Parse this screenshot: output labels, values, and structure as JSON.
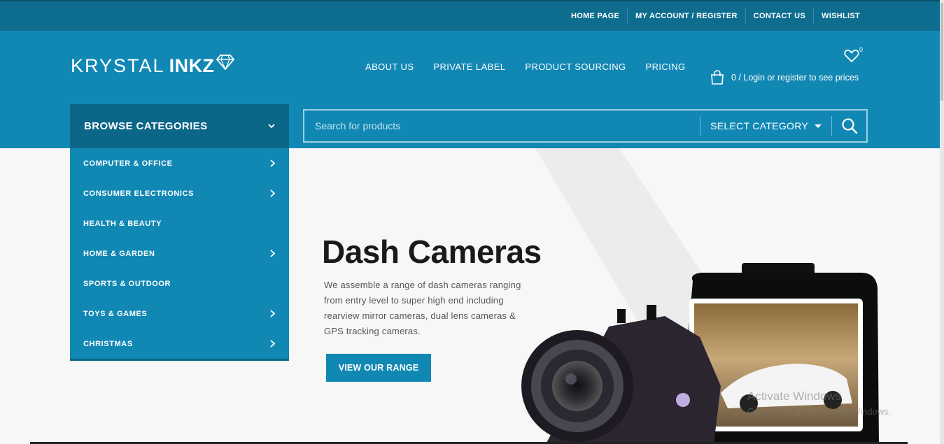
{
  "topbar": {
    "links": [
      "HOME PAGE",
      "MY ACCOUNT / REGISTER",
      "CONTACT US",
      "WISHLIST"
    ]
  },
  "logo": {
    "light": "KRYSTAL",
    "bold": "INKZ"
  },
  "mainnav": [
    "ABOUT US",
    "PRIVATE LABEL",
    "PRODUCT SOURCING",
    "PRICING"
  ],
  "wishlist": {
    "count": "0"
  },
  "cart": {
    "text": "0 / Login or register to see prices"
  },
  "browse": {
    "title": "BROWSE CATEGORIES"
  },
  "search": {
    "placeholder": "Search for products",
    "category": "SELECT CATEGORY"
  },
  "categories": [
    {
      "label": "COMPUTER & OFFICE",
      "has_sub": true
    },
    {
      "label": "CONSUMER ELECTRONICS",
      "has_sub": true
    },
    {
      "label": "HEALTH & BEAUTY",
      "has_sub": false
    },
    {
      "label": "HOME & GARDEN",
      "has_sub": true
    },
    {
      "label": "SPORTS & OUTDOOR",
      "has_sub": false
    },
    {
      "label": "TOYS & GAMES",
      "has_sub": true
    },
    {
      "label": "CHRISTMAS",
      "has_sub": true
    }
  ],
  "hero": {
    "title": "Dash Cameras",
    "text": "We assemble a range of dash cameras ranging from entry level to super high end including rearview mirror cameras, dual lens cameras & GPS tracking cameras.",
    "button": "VIEW OUR RANGE"
  },
  "watermark": {
    "line1": "Activate Windows",
    "line2": "Go to Settings to activate Windows."
  },
  "colors": {
    "topbar": "#0e6d8f",
    "header": "#1188b4",
    "browse": "#0b6687"
  }
}
